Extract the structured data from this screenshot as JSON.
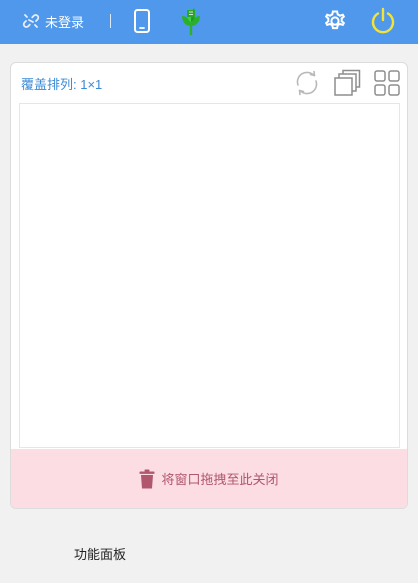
{
  "colors": {
    "topbar": "#4f98ec",
    "power_icon": "#f3e334",
    "plant_icon": "#2bb02b",
    "accent_text": "#3a8ad6",
    "trash_bg": "#fbdde3",
    "trash_text": "#b0566d"
  },
  "topbar": {
    "login_icon": "broken-link-icon",
    "login_label": "未登录",
    "icons": [
      "phone-icon",
      "plant-icon",
      "gear-icon",
      "power-icon"
    ]
  },
  "panel": {
    "layout_label": "覆盖排列: 1×1",
    "tools": [
      "refresh-icon",
      "cascade-windows-icon",
      "grid-layout-icon"
    ],
    "trash_icon": "trash-icon",
    "trash_label": "将窗口拖拽至此关闭"
  },
  "footer": {
    "function_panel_label": "功能面板"
  }
}
